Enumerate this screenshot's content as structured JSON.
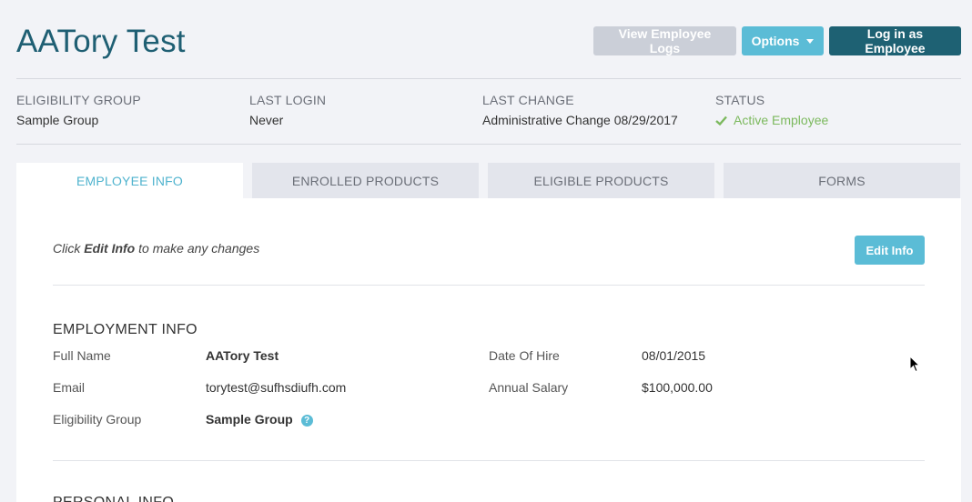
{
  "page_title": "AATory Test",
  "actions": {
    "view_logs": "View Employee Logs",
    "options": "Options",
    "login_as": "Log in as Employee"
  },
  "meta": [
    {
      "label": "ELIGIBILITY GROUP",
      "value": "Sample Group"
    },
    {
      "label": "LAST LOGIN",
      "value": "Never"
    },
    {
      "label": "LAST CHANGE",
      "value": "Administrative Change 08/29/2017"
    },
    {
      "label": "STATUS",
      "value": "Active Employee",
      "color": "#7cb95e",
      "icon": "check-icon"
    }
  ],
  "tabs": [
    {
      "label": "EMPLOYEE INFO",
      "active": true
    },
    {
      "label": "ENROLLED PRODUCTS",
      "active": false
    },
    {
      "label": "ELIGIBLE PRODUCTS",
      "active": false
    },
    {
      "label": "FORMS",
      "active": false
    }
  ],
  "hint": {
    "prefix": "Click ",
    "bold": "Edit Info",
    "suffix": " to make any changes"
  },
  "edit_button": "Edit Info",
  "employment": {
    "title": "EMPLOYMENT INFO",
    "full_name_label": "Full Name",
    "full_name": "AATory Test",
    "email_label": "Email",
    "email": "torytest@sufhsdiufh.com",
    "group_label": "Eligibility Group",
    "group": "Sample Group",
    "hire_label": "Date Of Hire",
    "hire": "08/01/2015",
    "salary_label": "Annual Salary",
    "salary": "$100,000.00"
  },
  "personal_title": "PERSONAL INFO",
  "colors": {
    "accent": "#5bbcd6",
    "dark": "#1e6173",
    "title": "#1f5f73",
    "status": "#7cb95e"
  }
}
